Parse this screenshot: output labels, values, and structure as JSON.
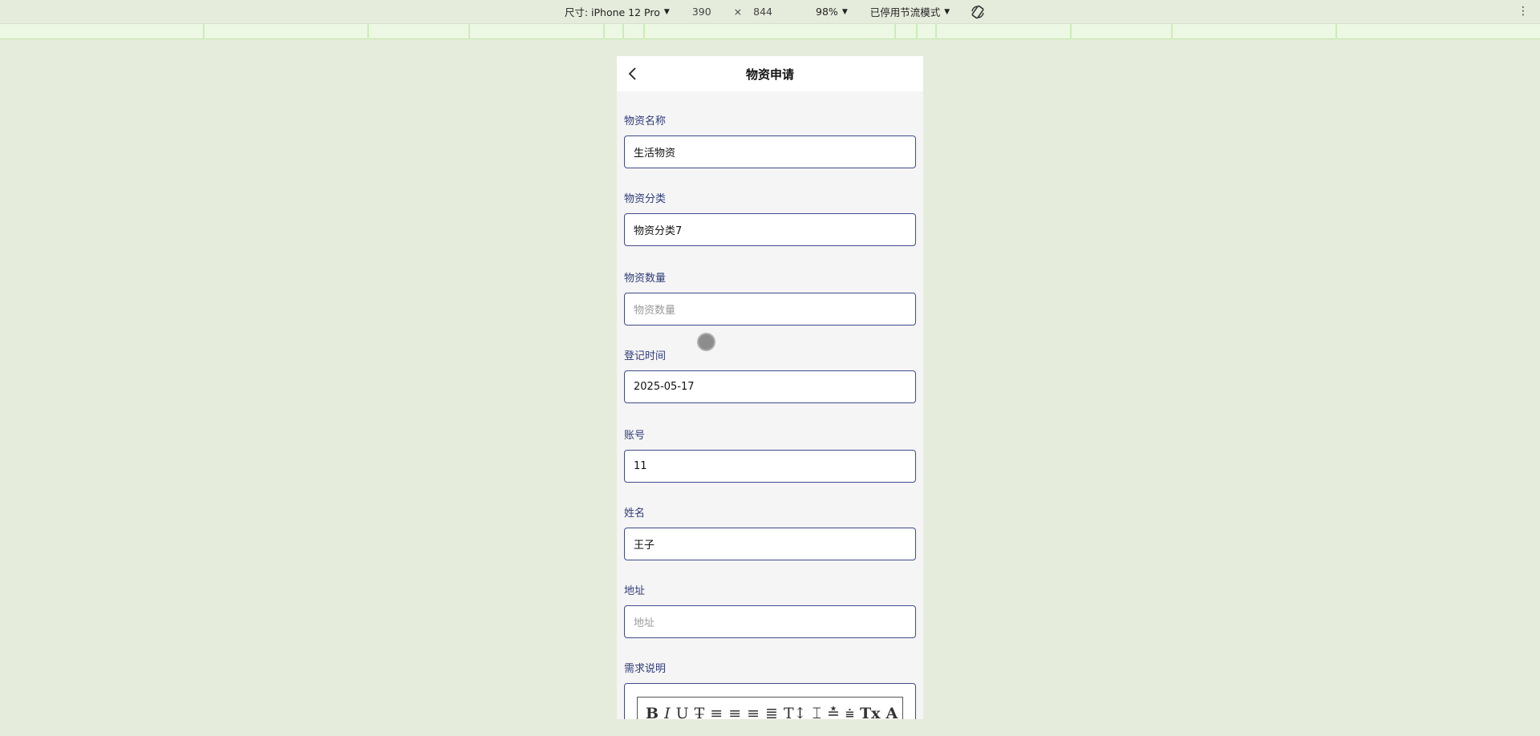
{
  "devtools": {
    "device_label": "尺寸: iPhone 12 Pro",
    "width": "390",
    "times": "×",
    "height": "844",
    "zoom": "98%",
    "throttle": "已停用节流模式",
    "more": "⋮"
  },
  "page": {
    "title": "物资申请",
    "back_icon": "chevron-left-icon"
  },
  "fields": [
    {
      "label": "物资名称",
      "value": "生活物资",
      "placeholder": ""
    },
    {
      "label": "物资分类",
      "value": "物资分类7",
      "placeholder": ""
    },
    {
      "label": "物资数量",
      "value": "",
      "placeholder": "物资数量"
    },
    {
      "label": "登记时间",
      "value": "2025-05-17",
      "placeholder": ""
    },
    {
      "label": "账号",
      "value": "11",
      "placeholder": ""
    },
    {
      "label": "姓名",
      "value": "王子",
      "placeholder": ""
    },
    {
      "label": "地址",
      "value": "",
      "placeholder": "地址"
    }
  ],
  "editor": {
    "label": "需求说明",
    "toolbar": [
      "B",
      "I",
      "U",
      "T̶",
      "≡",
      "≡",
      "≡",
      "≣",
      "T↕",
      "⌶",
      "≛",
      "⩧",
      "Tx",
      "A"
    ]
  },
  "colors": {
    "label": "#2e3b7a",
    "border": "#3f4a8c",
    "page_bg": "#e6ecdc"
  }
}
